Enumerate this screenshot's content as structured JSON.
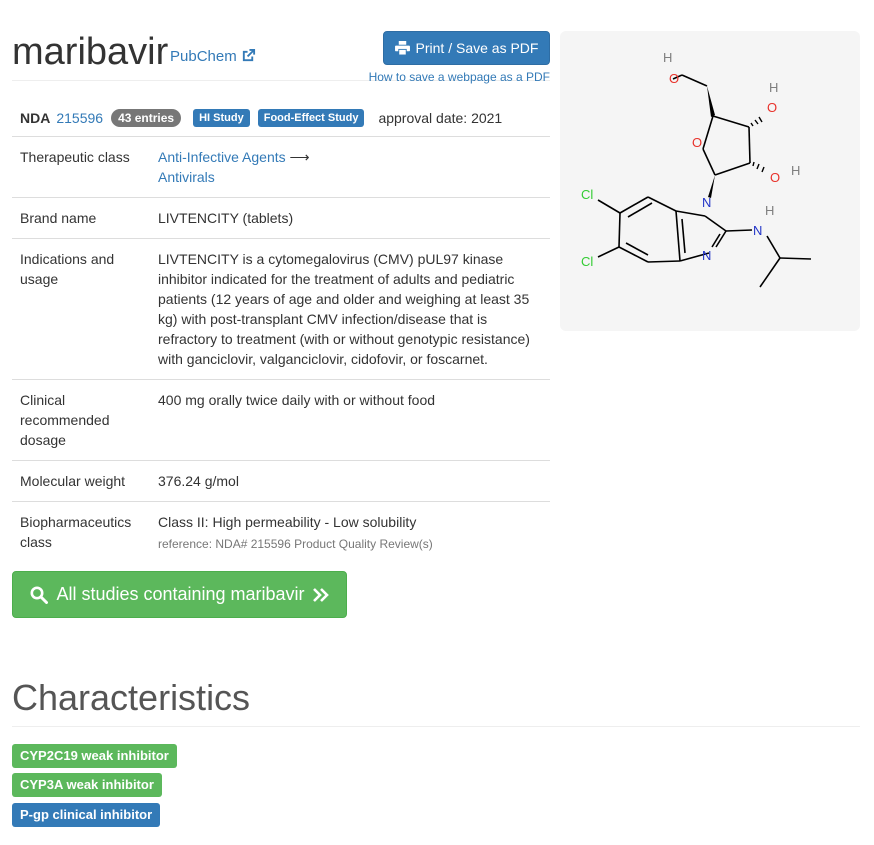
{
  "header": {
    "drug_name": "maribavir",
    "pubchem_label": "PubChem",
    "pdf_button_label": "Print / Save as PDF",
    "pdf_help_link": "How to save a webpage as a PDF"
  },
  "nda": {
    "label": "NDA",
    "number": "215596",
    "entries": "43 entries",
    "tags": [
      "HI Study",
      "Food-Effect Study"
    ],
    "approval": "approval date: 2021"
  },
  "info": {
    "therapeutic_class_label": "Therapeutic class",
    "therapeutic_class_1": "Anti-Infective Agents",
    "therapeutic_arrow": "⟶",
    "therapeutic_class_2": "Antivirals",
    "brand_label": "Brand name",
    "brand_value": "LIVTENCITY (tablets)",
    "indications_label": "Indications and usage",
    "indications_value": "LIVTENCITY is a cytomegalovirus (CMV) pUL97 kinase inhibitor indicated for the treatment of adults and pediatric patients (12 years of age and older and weighing at least 35 kg) with post-transplant CMV infection/disease that is refractory to treatment (with or without genotypic resistance) with ganciclovir, valganciclovir, cidofovir, or foscarnet.",
    "dosage_label": "Clinical recommended dosage",
    "dosage_value": "400 mg orally twice daily with or without food",
    "mw_label": "Molecular weight",
    "mw_value": "376.24 g/mol",
    "bcs_label": "Biopharmaceutics class",
    "bcs_value": "Class II: High permeability - Low solubility",
    "bcs_reference": "reference: NDA# 215596 Product Quality Review(s)"
  },
  "molecule": {
    "atoms": {
      "h": "H",
      "o": "O",
      "n": "N",
      "cl": "Cl"
    }
  },
  "studies_button": "All studies containing maribavir",
  "characteristics": {
    "heading": "Characteristics",
    "tags": [
      "CYP2C19 weak inhibitor",
      "CYP3A weak inhibitor",
      "P-gp clinical inhibitor"
    ]
  },
  "colors": {
    "primary": "#337ab7",
    "success": "#5cb85c",
    "oxygen": "#e8322b",
    "nitrogen": "#2234c8",
    "chlorine": "#33cc33"
  }
}
